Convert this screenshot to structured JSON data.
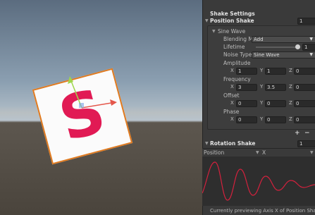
{
  "inspector": {
    "section_title": "Shake Settings",
    "position_shake": {
      "label": "Position Shake",
      "count": "1"
    },
    "sine_wave": {
      "label": "Sine Wave",
      "blending_mode": {
        "label": "Blending Mi",
        "value": "Add"
      },
      "lifetime": {
        "label": "Lifetime",
        "value": "1"
      },
      "noise_type": {
        "label": "Noise Type",
        "value": "Sine Wave"
      },
      "amplitude": {
        "label": "Amplitude",
        "x": "1",
        "y": "1",
        "z": "0"
      },
      "frequency": {
        "label": "Frequency",
        "x": "3",
        "y": "3.5",
        "z": "0"
      },
      "offset": {
        "label": "Offset",
        "x": "0",
        "y": "0",
        "z": "0"
      },
      "phase": {
        "label": "Phase",
        "x": "0",
        "y": "0",
        "z": "0"
      }
    },
    "add_label": "+",
    "remove_label": "−",
    "rotation_shake": {
      "label": "Rotation Shake",
      "count": "1"
    },
    "preview": {
      "property": "Position",
      "axis": "X"
    },
    "footer": "Currently previewing Axis X of Position Shake"
  },
  "scene": {
    "letter": "S"
  },
  "axis_labels": {
    "x": "X",
    "y": "Y",
    "z": "Z"
  },
  "colors": {
    "card_border": "#e07a1f",
    "letter": "#e11a54",
    "curve": "#d4213d",
    "gizmo_x": "#e4574b",
    "gizmo_y": "#9fd64c"
  }
}
